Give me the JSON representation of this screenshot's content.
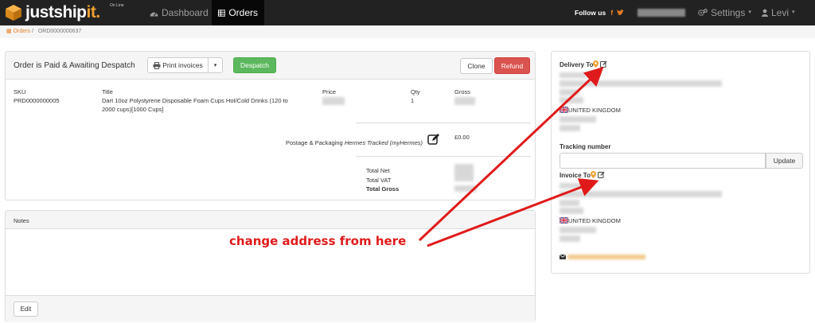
{
  "brand": {
    "name_a": "justship",
    "name_b": "it.",
    "sup": "On Line"
  },
  "nav": {
    "dashboard": "Dashboard",
    "orders": "Orders",
    "follow_us": "Follow us",
    "settings": "Settings",
    "user": "Levi"
  },
  "breadcrumb": {
    "orders": "Orders",
    "order_id": "ORD0000000637"
  },
  "order": {
    "status": "Order is Paid & Awaiting Despatch",
    "print_invoices": "Print invoices",
    "despatch": "Despatch",
    "clone": "Clone",
    "refund": "Refund",
    "columns": {
      "sku": "SKU",
      "title": "Title",
      "price": "Price",
      "qty": "Qty",
      "gross": "Gross"
    },
    "line": {
      "sku": "PRD0000000005",
      "title_line1": "Dart 10oz Polystyrene Disposable Foam Cups Hot/Cold Drinks (120 to",
      "title_line2": "2000 cups)[1000 Cups]",
      "qty": "1"
    },
    "postage_label": "Postage & Packaging",
    "postage_method": "Hermes Tracked (myHermes)",
    "postage_value": "£0.00",
    "total_net": "Total Net",
    "total_vat": "Total VAT",
    "total_gross": "Total Gross"
  },
  "notes": {
    "title": "Notes",
    "edit": "Edit"
  },
  "address": {
    "delivery_to": "Delivery To",
    "delivery_country": "UNITED KINGDOM",
    "tracking_label": "Tracking number",
    "tracking_value": "",
    "update": "Update",
    "invoice_to": "Invoice To",
    "invoice_country": "UNITED KINGDOM"
  },
  "annotation": {
    "text": "change address from here"
  },
  "colors": {
    "accent": "#e67e22",
    "annotation": "#e01a1a",
    "despatch": "#5cb85c",
    "refund": "#d9534f"
  }
}
